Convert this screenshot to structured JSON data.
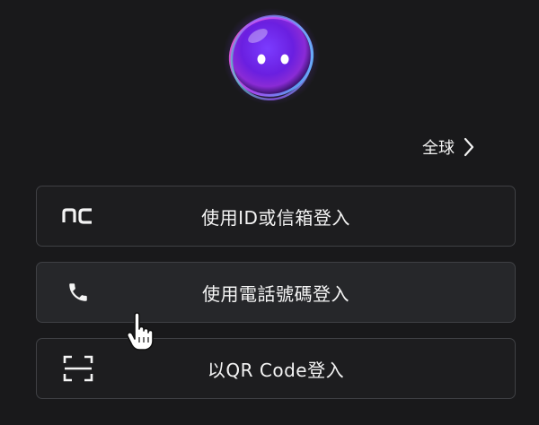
{
  "region": {
    "label": "全球",
    "icon": "chevron-right-icon"
  },
  "login_options": [
    {
      "label": "使用ID或信箱登入",
      "icon": "nc-logo-icon"
    },
    {
      "label": "使用電話號碼登入",
      "icon": "phone-icon"
    },
    {
      "label": "以QR Code登入",
      "icon": "qr-scan-icon"
    }
  ],
  "colors": {
    "background": "#19191b",
    "button_border": "#3f4044",
    "button_background": "#1d1d1f",
    "button_hover_background": "#26272a",
    "text": "#f4f4f4"
  }
}
